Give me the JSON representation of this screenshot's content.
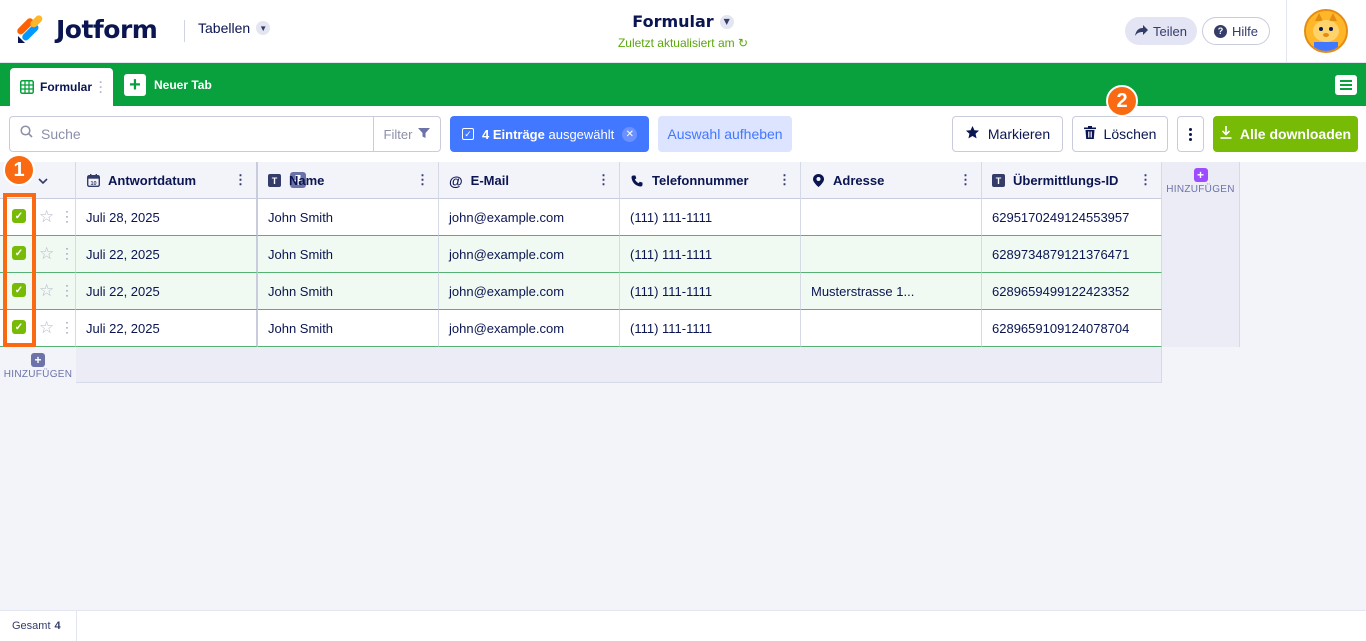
{
  "header": {
    "logo_text": "Jotform",
    "tables_menu": "Tabellen",
    "form_title": "Formular",
    "last_updated": "Zuletzt aktualisiert am",
    "share": "Teilen",
    "help": "Hilfe"
  },
  "tabs": {
    "active": "Formular",
    "new_tab": "Neuer Tab"
  },
  "toolbar": {
    "search_placeholder": "Suche",
    "filter": "Filter",
    "selected_count": "4 Einträge",
    "selected_suffix": "ausgewählt",
    "clear_selection": "Auswahl aufheben",
    "mark": "Markieren",
    "delete": "Löschen",
    "download_all": "Alle downloaden"
  },
  "table": {
    "columns": [
      "Antwortdatum",
      "Name",
      "E-Mail",
      "Telefonnummer",
      "Adresse",
      "Übermittlungs-ID"
    ],
    "add_label": "HINZUFÜGEN",
    "rows": [
      {
        "date": "Juli 28, 2025",
        "name": "John Smith",
        "email": "john@example.com",
        "phone": "(111) 111-1111",
        "address": "",
        "id": "6295170249124553957"
      },
      {
        "date": "Juli 22, 2025",
        "name": "John Smith",
        "email": "john@example.com",
        "phone": "(111) 111-1111",
        "address": "",
        "id": "6289734879121376471"
      },
      {
        "date": "Juli 22, 2025",
        "name": "John Smith",
        "email": "john@example.com",
        "phone": "(111) 111-1111",
        "address": "Musterstrasse 1...",
        "id": "6289659499122423352"
      },
      {
        "date": "Juli 22, 2025",
        "name": "John Smith",
        "email": "john@example.com",
        "phone": "(111) 111-1111",
        "address": "",
        "id": "6289659109124078704"
      }
    ]
  },
  "annotations": {
    "step1": "1",
    "step2": "2"
  },
  "footer": {
    "total_label": "Gesamt",
    "total_value": "4"
  },
  "colors": {
    "brand_green": "#08a13d",
    "accent_blue": "#4277ff",
    "download_green": "#78bb07",
    "annotation_orange": "#f96a12",
    "row_selected": "#f0faf2",
    "navy": "#0a1551"
  }
}
